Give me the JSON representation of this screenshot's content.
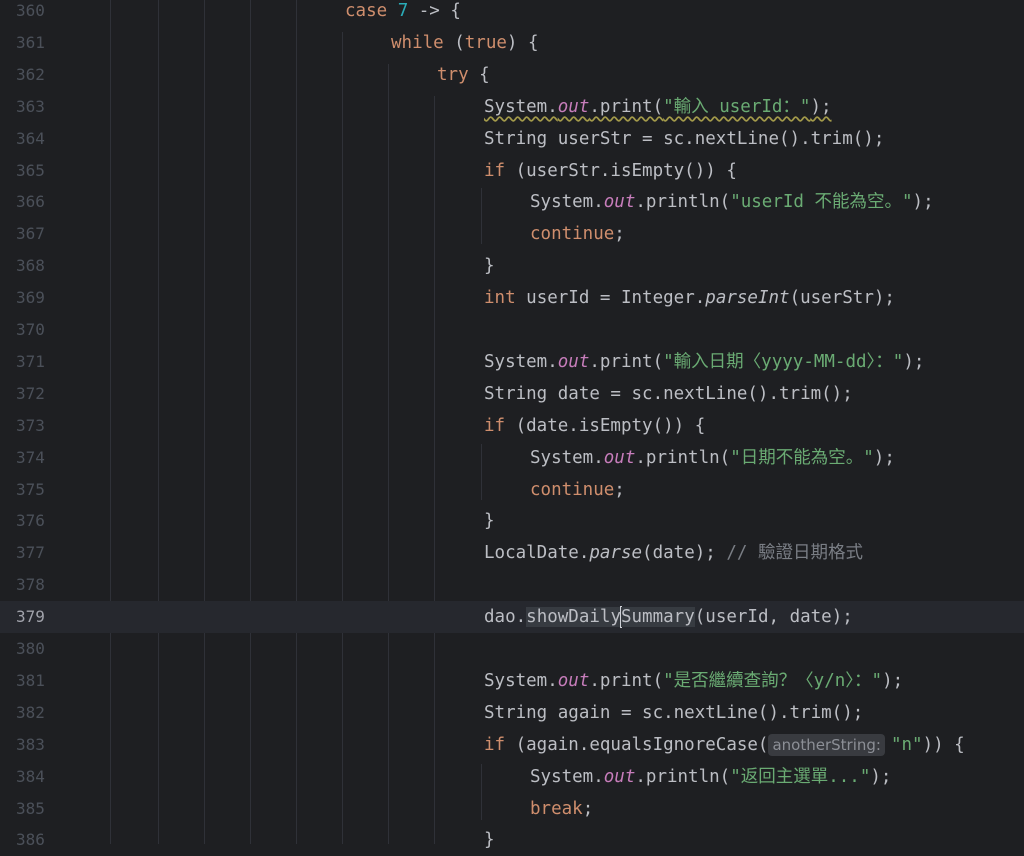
{
  "editor": {
    "lines": [
      {
        "num": "360",
        "indent": 0,
        "tokens": []
      },
      {
        "num": "361",
        "indent": 1,
        "tokens": []
      },
      {
        "num": "362",
        "indent": 2,
        "tokens": []
      },
      {
        "num": "363",
        "indent": 3,
        "tokens": []
      },
      {
        "num": "364",
        "indent": 3,
        "tokens": []
      },
      {
        "num": "365",
        "indent": 3,
        "tokens": []
      },
      {
        "num": "366",
        "indent": 4,
        "tokens": []
      },
      {
        "num": "367",
        "indent": 4,
        "tokens": []
      },
      {
        "num": "368",
        "indent": 3,
        "tokens": []
      },
      {
        "num": "369",
        "indent": 3,
        "tokens": []
      },
      {
        "num": "370",
        "indent": 3,
        "tokens": []
      },
      {
        "num": "371",
        "indent": 3,
        "tokens": []
      },
      {
        "num": "372",
        "indent": 3,
        "tokens": []
      },
      {
        "num": "373",
        "indent": 3,
        "tokens": []
      },
      {
        "num": "374",
        "indent": 4,
        "tokens": []
      },
      {
        "num": "375",
        "indent": 4,
        "tokens": []
      },
      {
        "num": "376",
        "indent": 3,
        "tokens": []
      },
      {
        "num": "377",
        "indent": 3,
        "tokens": []
      },
      {
        "num": "378",
        "indent": 3,
        "tokens": []
      },
      {
        "num": "379",
        "indent": 3,
        "tokens": []
      },
      {
        "num": "380",
        "indent": 3,
        "tokens": []
      },
      {
        "num": "381",
        "indent": 3,
        "tokens": []
      },
      {
        "num": "382",
        "indent": 3,
        "tokens": []
      },
      {
        "num": "383",
        "indent": 3,
        "tokens": []
      },
      {
        "num": "384",
        "indent": 4,
        "tokens": []
      },
      {
        "num": "385",
        "indent": 4,
        "tokens": []
      },
      {
        "num": "386",
        "indent": 3,
        "tokens": []
      }
    ],
    "current_line": "379"
  },
  "code": {
    "l360": [
      {
        "t": "case ",
        "c": "kw"
      },
      {
        "t": "7",
        "c": "num"
      },
      {
        "t": " -> {",
        "c": ""
      }
    ],
    "l361": [
      {
        "t": "while ",
        "c": "kw"
      },
      {
        "t": "(",
        "c": ""
      },
      {
        "t": "true",
        "c": "kw"
      },
      {
        "t": ") {",
        "c": ""
      }
    ],
    "l362": [
      {
        "t": "try ",
        "c": "kw"
      },
      {
        "t": "{",
        "c": ""
      }
    ],
    "l363": [
      {
        "t": "System.",
        "c": "wavy"
      },
      {
        "t": "out",
        "c": "field wavy"
      },
      {
        "t": ".print(",
        "c": "wavy"
      },
      {
        "t": "\"輸入 userId：\"",
        "c": "str wavy"
      },
      {
        "t": ");",
        "c": "wavy"
      }
    ],
    "l364": [
      {
        "t": "String userStr = sc.nextLine().trim();",
        "c": ""
      }
    ],
    "l365": [
      {
        "t": "if ",
        "c": "kw"
      },
      {
        "t": "(userStr.isEmpty()) {",
        "c": ""
      }
    ],
    "l366": [
      {
        "t": "System.",
        "c": ""
      },
      {
        "t": "out",
        "c": "field"
      },
      {
        "t": ".println(",
        "c": ""
      },
      {
        "t": "\"userId 不能為空。\"",
        "c": "str"
      },
      {
        "t": ");",
        "c": ""
      }
    ],
    "l367": [
      {
        "t": "continue",
        "c": "kw"
      },
      {
        "t": ";",
        "c": ""
      }
    ],
    "l368": [
      {
        "t": "}",
        "c": ""
      }
    ],
    "l369": [
      {
        "t": "int ",
        "c": "kw"
      },
      {
        "t": "userId = Integer.",
        "c": ""
      },
      {
        "t": "parseInt",
        "c": "smeth"
      },
      {
        "t": "(userStr);",
        "c": ""
      }
    ],
    "l370": [],
    "l371": [
      {
        "t": "System.",
        "c": ""
      },
      {
        "t": "out",
        "c": "field"
      },
      {
        "t": ".print(",
        "c": ""
      },
      {
        "t": "\"輸入日期〈yyyy-MM-dd〉：\"",
        "c": "str"
      },
      {
        "t": ");",
        "c": ""
      }
    ],
    "l372": [
      {
        "t": "String date = sc.nextLine().trim();",
        "c": ""
      }
    ],
    "l373": [
      {
        "t": "if ",
        "c": "kw"
      },
      {
        "t": "(date.isEmpty()) {",
        "c": ""
      }
    ],
    "l374": [
      {
        "t": "System.",
        "c": ""
      },
      {
        "t": "out",
        "c": "field"
      },
      {
        "t": ".println(",
        "c": ""
      },
      {
        "t": "\"日期不能為空。\"",
        "c": "str"
      },
      {
        "t": ");",
        "c": ""
      }
    ],
    "l375": [
      {
        "t": "continue",
        "c": "kw"
      },
      {
        "t": ";",
        "c": ""
      }
    ],
    "l376": [
      {
        "t": "}",
        "c": ""
      }
    ],
    "l377": [
      {
        "t": "LocalDate.",
        "c": ""
      },
      {
        "t": "parse",
        "c": "smeth"
      },
      {
        "t": "(date); ",
        "c": ""
      },
      {
        "t": "// 驗證日期格式",
        "c": "cmt"
      }
    ],
    "l378": [],
    "l379": [
      {
        "t": "dao.",
        "c": ""
      },
      {
        "t": "showDaily",
        "c": "hl"
      },
      {
        "t": "|",
        "c": "caret"
      },
      {
        "t": "Summary",
        "c": "hl"
      },
      {
        "t": "(userId, date);",
        "c": ""
      }
    ],
    "l380": [],
    "l381": [
      {
        "t": "System.",
        "c": ""
      },
      {
        "t": "out",
        "c": "field"
      },
      {
        "t": ".print(",
        "c": ""
      },
      {
        "t": "\"是否繼續查詢？〈y/n〉：\"",
        "c": "str"
      },
      {
        "t": ");",
        "c": ""
      }
    ],
    "l382": [
      {
        "t": "String again = sc.nextLine().trim();",
        "c": ""
      }
    ],
    "l383": [
      {
        "t": "if ",
        "c": "kw"
      },
      {
        "t": "(again.equalsIgnoreCase(",
        "c": ""
      },
      {
        "t": "anotherString:",
        "c": "hint"
      },
      {
        "t": "\"n\"",
        "c": "str"
      },
      {
        "t": ")) {",
        "c": ""
      }
    ],
    "l384": [
      {
        "t": "System.",
        "c": ""
      },
      {
        "t": "out",
        "c": "field"
      },
      {
        "t": ".println(",
        "c": ""
      },
      {
        "t": "\"返回主選單...\"",
        "c": "str"
      },
      {
        "t": ");",
        "c": ""
      }
    ],
    "l385": [
      {
        "t": "break",
        "c": "kw"
      },
      {
        "t": ";",
        "c": ""
      }
    ],
    "l386": [
      {
        "t": "}",
        "c": ""
      }
    ]
  },
  "colors": {
    "background": "#1e1f22",
    "keyword": "#cf8e6d",
    "string": "#6aab73",
    "number": "#2aacb8",
    "field": "#c77dbb",
    "comment": "#7a7e85",
    "text": "#bcbec4"
  }
}
